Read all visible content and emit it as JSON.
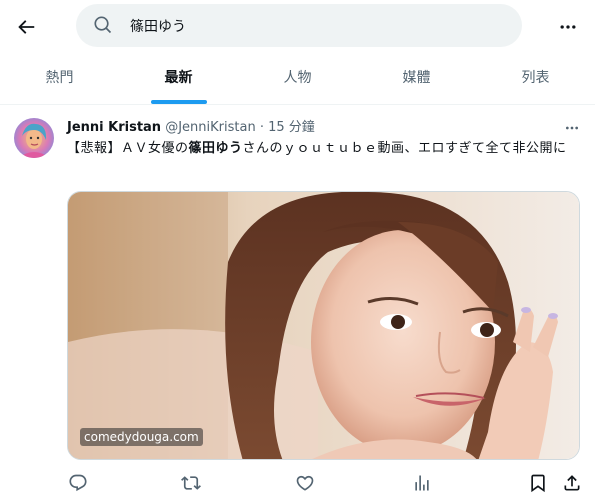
{
  "header": {
    "back_icon": "arrow-left-icon",
    "search": {
      "value": "篠田ゆう",
      "icon": "search-icon"
    },
    "more_icon": "ellipsis-icon"
  },
  "tabs": [
    {
      "label": "熱門",
      "active": false
    },
    {
      "label": "最新",
      "active": true
    },
    {
      "label": "人物",
      "active": false
    },
    {
      "label": "媒體",
      "active": false
    },
    {
      "label": "列表",
      "active": false
    }
  ],
  "tweet": {
    "author_name": "Jenni Kristan",
    "handle": "@JenniKristan",
    "separator": "·",
    "time": "15 分鐘",
    "text_prefix": "【悲報】ＡＶ女優の",
    "text_highlight": "篠田ゆう",
    "text_suffix": "さんのｙｏｕｔｕｂｅ動画、エロすぎて全て非公開に",
    "media_watermark": "comedydouga.com",
    "actions": [
      "reply-icon",
      "retweet-icon",
      "like-icon",
      "views-icon",
      "bookmark-icon",
      "share-icon"
    ]
  },
  "colors": {
    "accent": "#1d9bf0",
    "text_primary": "#0f1419",
    "text_secondary": "#536471",
    "search_bg": "#eff3f4"
  }
}
